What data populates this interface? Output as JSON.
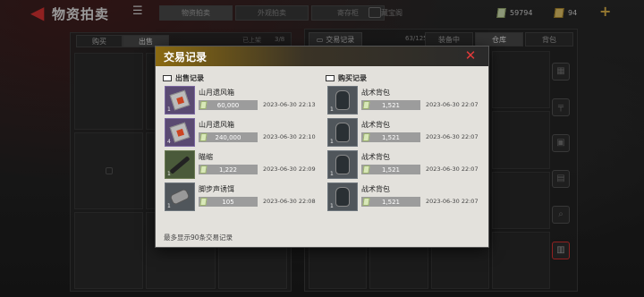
{
  "topbar": {
    "title": "物资拍卖",
    "tabs": [
      {
        "label": "物资拍卖",
        "active": true
      },
      {
        "label": "外观拍卖",
        "active": false
      },
      {
        "label": "寄存柜",
        "active": false
      }
    ],
    "mid_label": "藏宝阁",
    "money_value": "59794",
    "gold_value": "94"
  },
  "left_panel": {
    "tabs": [
      {
        "label": "购买",
        "active": false
      },
      {
        "label": "出售",
        "active": true
      }
    ],
    "status": "已上架",
    "count": "3/8"
  },
  "right_panel": {
    "record_button": "交易记录",
    "capacity": "63/125",
    "tabs": [
      {
        "label": "装备中",
        "active": false
      },
      {
        "label": "仓库",
        "active": true
      },
      {
        "label": "背包",
        "active": false
      }
    ]
  },
  "modal": {
    "title": "交易记录",
    "sell": {
      "heading": "出售记录",
      "records": [
        {
          "name": "山月遗风箱",
          "price": "60,000",
          "time": "2023-06-30 22:13",
          "tier": "1",
          "thumb": "crate",
          "color": "purple"
        },
        {
          "name": "山月遗风箱",
          "price": "240,000",
          "time": "2023-06-30 22:10",
          "tier": "4",
          "thumb": "crate",
          "color": "purple"
        },
        {
          "name": "瞄缩",
          "price": "1,222",
          "time": "2023-06-30 22:09",
          "tier": "1",
          "thumb": "scope",
          "color": "green"
        },
        {
          "name": "脚步声诱饵",
          "price": "105",
          "time": "2023-06-30 22:08",
          "tier": "1",
          "thumb": "lure",
          "color": "gray"
        }
      ]
    },
    "buy": {
      "heading": "购买记录",
      "records": [
        {
          "name": "战术背包",
          "price": "1,521",
          "time": "2023-06-30 22:07",
          "tier": "1",
          "thumb": "pack",
          "color": "gray"
        },
        {
          "name": "战术背包",
          "price": "1,521",
          "time": "2023-06-30 22:07",
          "tier": "1",
          "thumb": "pack",
          "color": "gray"
        },
        {
          "name": "战术背包",
          "price": "1,521",
          "time": "2023-06-30 22:07",
          "tier": "1",
          "thumb": "pack",
          "color": "gray"
        },
        {
          "name": "战术背包",
          "price": "1,521",
          "time": "2023-06-30 22:07",
          "tier": "1",
          "thumb": "pack",
          "color": "gray"
        }
      ]
    },
    "footer": "最多显示90条交易记录"
  },
  "icons": {
    "back": "back-arrow-icon",
    "menu": "list-icon",
    "close": "close-icon",
    "money": "cash-icon",
    "gold": "gold-bar-icon",
    "plus": "plus-icon"
  },
  "colors": {
    "accent_red": "#e03a3a",
    "header_gold": "#8a6a12",
    "modal_bg": "#e3e1dc"
  }
}
